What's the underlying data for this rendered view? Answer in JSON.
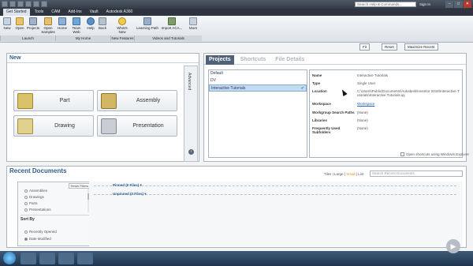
{
  "window": {
    "help_search_placeholder": "Search Help & Commands...",
    "user": "Sign In",
    "controls": [
      "−",
      "□",
      "✕"
    ]
  },
  "ribbon_tabs": [
    {
      "label": "Get Started",
      "active": true
    },
    {
      "label": "Tools"
    },
    {
      "label": "CAM"
    },
    {
      "label": "Add-Ins"
    },
    {
      "label": "Vault"
    },
    {
      "label": "Autodesk A360"
    }
  ],
  "ribbon": {
    "launch": {
      "label": "Launch",
      "buttons": [
        "New",
        "Open",
        "Projects",
        "Open Samples"
      ]
    },
    "my_home": {
      "label": "My Home",
      "buttons": [
        "Home",
        "Team Web",
        "Help",
        "Back"
      ]
    },
    "new_features": {
      "label": "New Features",
      "buttons": [
        "What's New"
      ]
    },
    "videos": {
      "label": "Videos and Tutorials",
      "buttons": [
        "Learning Path",
        "Import ACA...",
        "More"
      ]
    }
  },
  "top_buttons": {
    "fit": "Fit",
    "reset": "Reset",
    "maximize": "Maximize Recent"
  },
  "new_panel": {
    "title": "New",
    "buttons": [
      "Part",
      "Assembly",
      "Drawing",
      "Presentation"
    ],
    "advanced": "Advanced"
  },
  "projects_panel": {
    "tabs": [
      "Projects",
      "Shortcuts",
      "File Details"
    ],
    "projects": [
      "Default",
      "DV",
      "Interactive Tutorials"
    ],
    "selected_index": 2,
    "properties": [
      {
        "key": "Name",
        "value": "Interactive Tutorials"
      },
      {
        "key": "Type",
        "value": "Single User"
      },
      {
        "key": "Location",
        "value": "C:\\Users\\Public\\Documents\\Autodesk\\Inventor 2016\\Interactive Tutorials\\Interactive Tutorials.ipj"
      },
      {
        "key": "Workspace",
        "value": "Workspace",
        "link": true
      },
      {
        "key": "Workgroup Search Paths",
        "value": "(None)"
      },
      {
        "key": "Libraries",
        "value": "(None)"
      },
      {
        "key": "Frequently Used Subfolders",
        "value": "(None)"
      }
    ],
    "explorer_option": "Open shortcuts using Windows Explorer"
  },
  "recent_panel": {
    "title": "Recent Documents",
    "view_modes": [
      "Tiles",
      "Large",
      "Small",
      "List"
    ],
    "active_view": "Small",
    "search_placeholder": "Search Recent Documents",
    "reset_filters": "Reset Filters",
    "filters": [
      "Assemblies",
      "Drawings",
      "Parts",
      "Presentations"
    ],
    "sort_by_label": "Sort By",
    "sort_options": [
      "Recently Opened",
      "Date Modified"
    ],
    "sort_selected": 1,
    "pinned": "Pinned (0 Files) ▾",
    "unpinned": "Unpinned (0 Files) ▾"
  },
  "colors": {
    "accent": "#2c5e8f",
    "selected_tab": "#4f6277",
    "selection": "#c3dbf1"
  }
}
